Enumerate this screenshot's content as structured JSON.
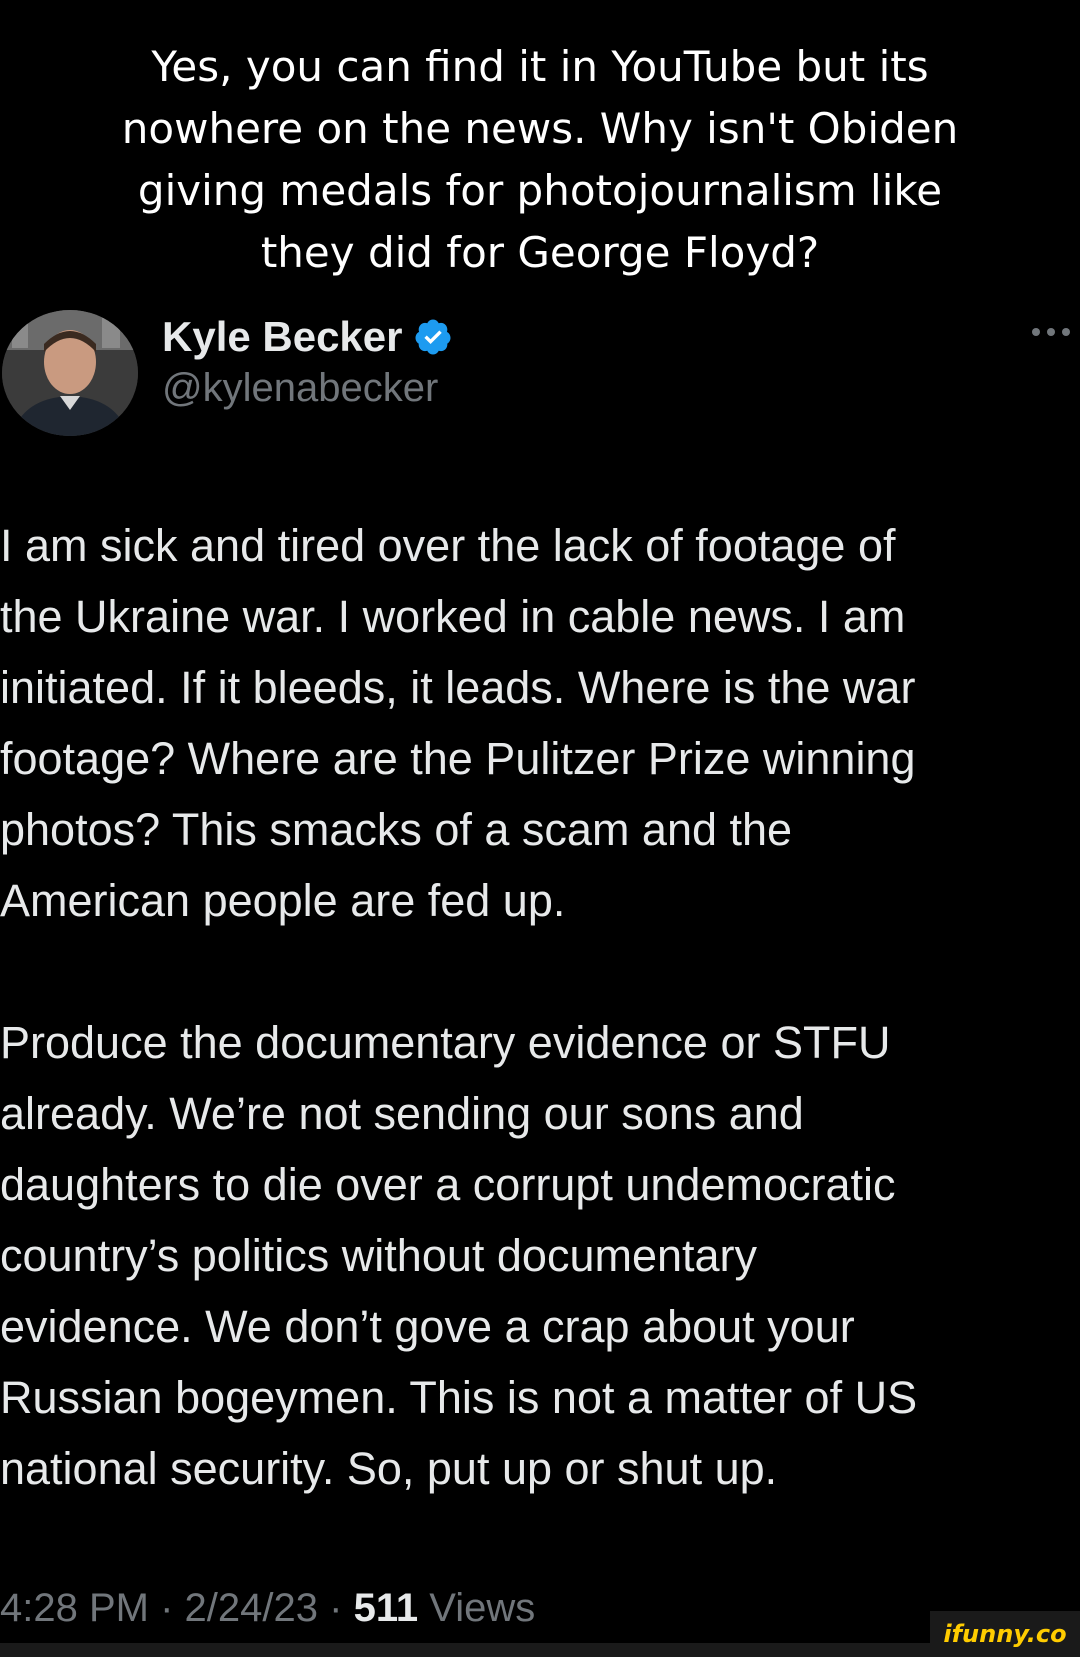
{
  "caption": {
    "line1": "Yes, you can find it in YouTube but its",
    "line2": "nowhere on the news. Why isn't Obiden",
    "line3": "giving medals for photojournalism like",
    "line4": "they did for George Floyd?"
  },
  "tweet": {
    "display_name": "Kyle Becker",
    "handle": "@kylenabecker",
    "paragraph1": "I am sick and tired over the lack of footage of\nthe Ukraine war. I worked in cable news. I am\ninitiated. If it bleeds, it leads. Where is the war\nfootage? Where are the Pulitzer Prize winning\nphotos? This smacks of a scam and the\nAmerican people are fed up.",
    "paragraph2": "Produce the documentary evidence or STFU\nalready. We’re not sending our sons and\ndaughters to die over a corrupt undemocratic\ncountry’s politics without documentary\nevidence.  We don’t gove a crap about your\nRussian bogeymen. This is not a matter of US\nnational security. So, put up or shut up.",
    "time": "4:28 PM",
    "date": "2/24/23",
    "views_count": "511",
    "views_label": "Views",
    "separator": "·"
  },
  "icons": {
    "verified": "verified-badge-icon",
    "more": "more-options-icon"
  },
  "colors": {
    "background": "#000000",
    "text": "#e7e9ea",
    "secondary_text": "#71767b",
    "verified_blue": "#1d9bf0"
  },
  "watermark": {
    "text": "ifunny.co"
  }
}
